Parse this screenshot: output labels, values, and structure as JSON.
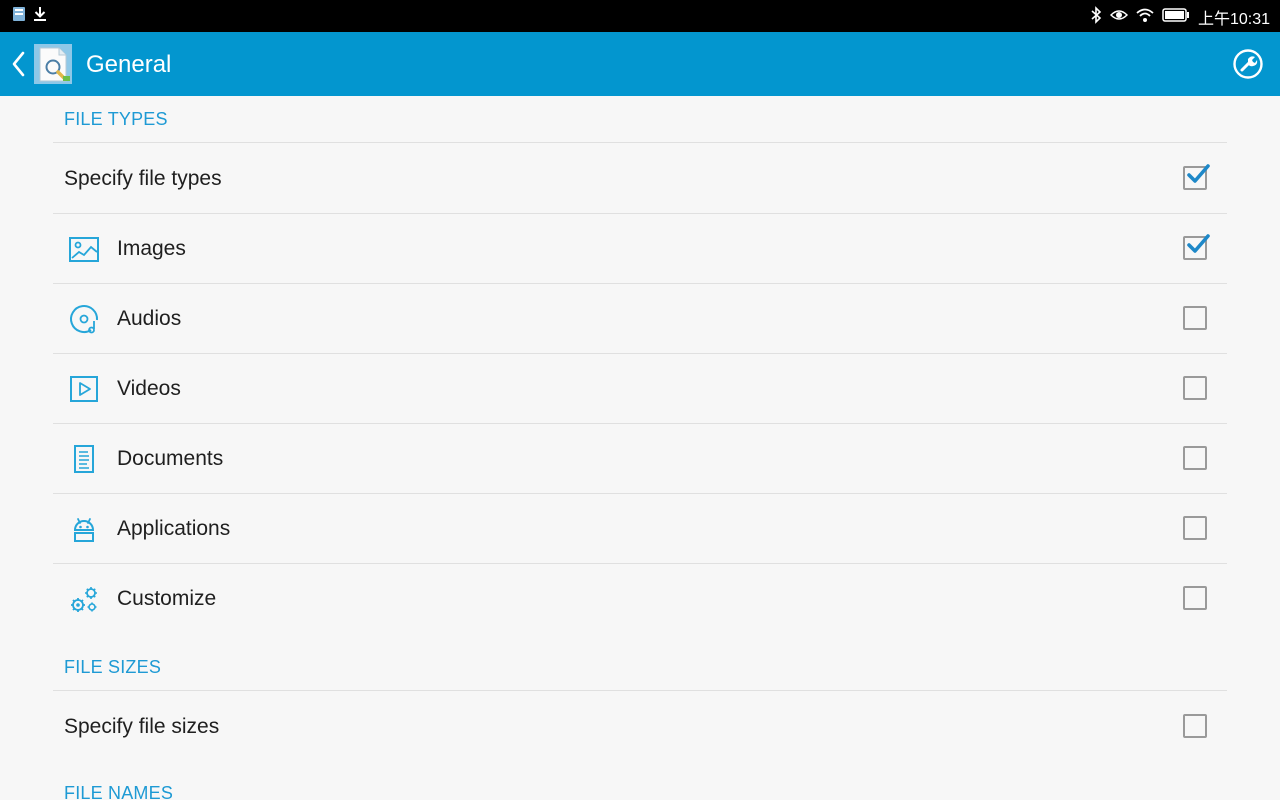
{
  "status_bar": {
    "time": "上午10:31",
    "icons": [
      "notification-app-icon",
      "download-icon",
      "bluetooth-icon",
      "eye-icon",
      "wifi-icon",
      "battery-icon"
    ]
  },
  "app_bar": {
    "title": "General",
    "back_icon": "back-icon",
    "app_icon": "app-icon",
    "tool_icon": "wrench-icon"
  },
  "colors": {
    "accent": "#0396cf",
    "section_header": "#1e9ad4",
    "icon": "#26a6d9",
    "checkmark": "#1e88c8"
  },
  "sections": [
    {
      "header": "FILE TYPES",
      "rows": [
        {
          "label": "Specify file types",
          "checked": true,
          "icon": null
        },
        {
          "label": "Images",
          "checked": true,
          "icon": "image-icon"
        },
        {
          "label": "Audios",
          "checked": false,
          "icon": "audio-icon"
        },
        {
          "label": "Videos",
          "checked": false,
          "icon": "video-icon"
        },
        {
          "label": "Documents",
          "checked": false,
          "icon": "document-icon"
        },
        {
          "label": "Applications",
          "checked": false,
          "icon": "android-icon"
        },
        {
          "label": "Customize",
          "checked": false,
          "icon": "gears-icon"
        }
      ]
    },
    {
      "header": "FILE SIZES",
      "rows": [
        {
          "label": "Specify file sizes",
          "checked": false,
          "icon": null
        }
      ]
    },
    {
      "header": "FILE NAMES",
      "rows": []
    }
  ]
}
